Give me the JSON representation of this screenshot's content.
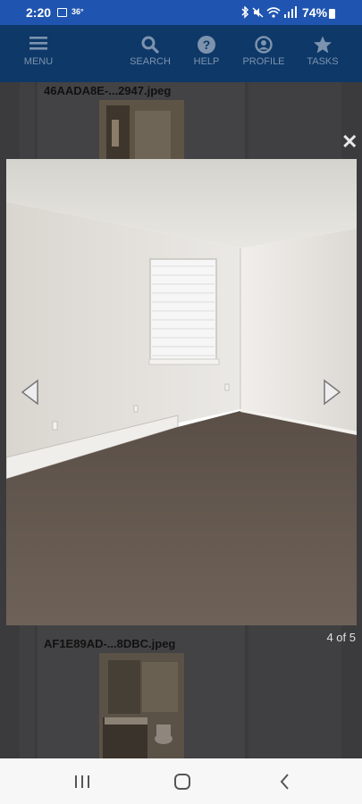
{
  "status_bar": {
    "time": "2:20",
    "temperature": "36°",
    "battery_percent": "74%",
    "icons": [
      "image-icon",
      "bluetooth-icon",
      "mute-icon",
      "wifi-icon",
      "signal-icon",
      "battery-icon"
    ]
  },
  "app_nav": {
    "menu_label": "MENU",
    "search_label": "SEARCH",
    "help_label": "HELP",
    "profile_label": "PROFILE",
    "tasks_label": "TASKS"
  },
  "gallery": {
    "top_item_title": "46AADA8E-...2947.jpeg",
    "bottom_item_title": "AF1E89AD-...8DBC.jpeg"
  },
  "lightbox": {
    "close_glyph": "✕",
    "counter": "4 of 5",
    "current_index": 4,
    "total": 5
  },
  "colors": {
    "status_bar": "#1f55b0",
    "app_nav": "#0d3868",
    "overlay": "#3b3b3d"
  }
}
